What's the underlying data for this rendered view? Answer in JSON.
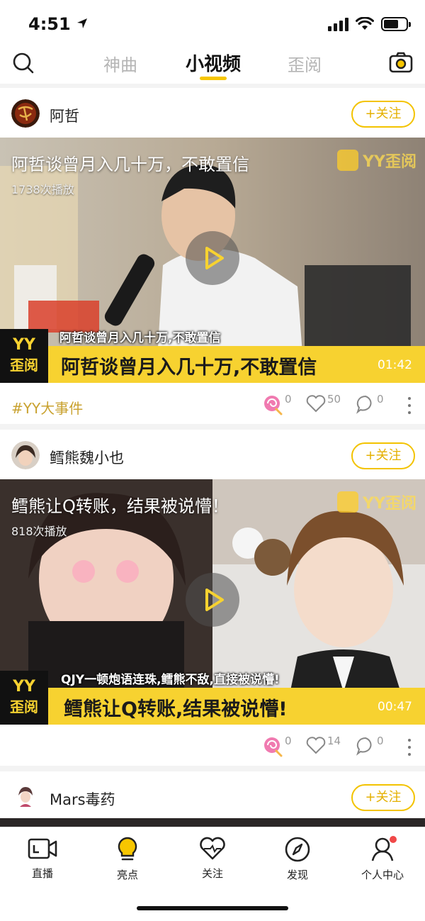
{
  "status_bar": {
    "time": "4:51"
  },
  "top_nav": {
    "tabs": [
      {
        "label": "神曲",
        "active": false
      },
      {
        "label": "小视频",
        "active": true
      },
      {
        "label": "歪阅",
        "active": false
      }
    ]
  },
  "feed": [
    {
      "author": "阿哲",
      "follow_label": "+关注",
      "title": "阿哲谈曾月入几十万，不敢置信",
      "play_count": "1738次播放",
      "watermark": "YY歪阅",
      "subtitle": "阿哲谈曾月入几十万,不敢置信",
      "caption": "阿哲谈曾月入几十万,不敢置信",
      "duration": "01:42",
      "logo_line1": "YY",
      "logo_line2": "歪阅",
      "hashtag": "#YY大事件",
      "gifts": "0",
      "likes": "50",
      "comments": "0"
    },
    {
      "author": "鳕熊魏小也",
      "follow_label": "+关注",
      "title": "鳕熊让Q转账，结果被说懵！",
      "play_count": "818次播放",
      "watermark": "YY歪阅",
      "subtitle": "QJY一顿炮语连珠,鳕熊不敌,直接被说懵!",
      "caption": "鳕熊让Q转账,结果被说懵!",
      "duration": "00:47",
      "logo_line1": "YY",
      "logo_line2": "歪阅",
      "gifts": "0",
      "likes": "14",
      "comments": "0"
    },
    {
      "author": "Mars毒药",
      "follow_label": "+关注"
    }
  ],
  "bottom_tabs": [
    {
      "label": "直播",
      "icon": "live-icon"
    },
    {
      "label": "亮点",
      "icon": "bulb-icon"
    },
    {
      "label": "关注",
      "icon": "heart-icon"
    },
    {
      "label": "发现",
      "icon": "compass-icon"
    },
    {
      "label": "个人中心",
      "icon": "person-icon"
    }
  ],
  "colors": {
    "accent": "#f7c600",
    "brand_yellow": "#f7d230",
    "notification": "#f04848"
  }
}
